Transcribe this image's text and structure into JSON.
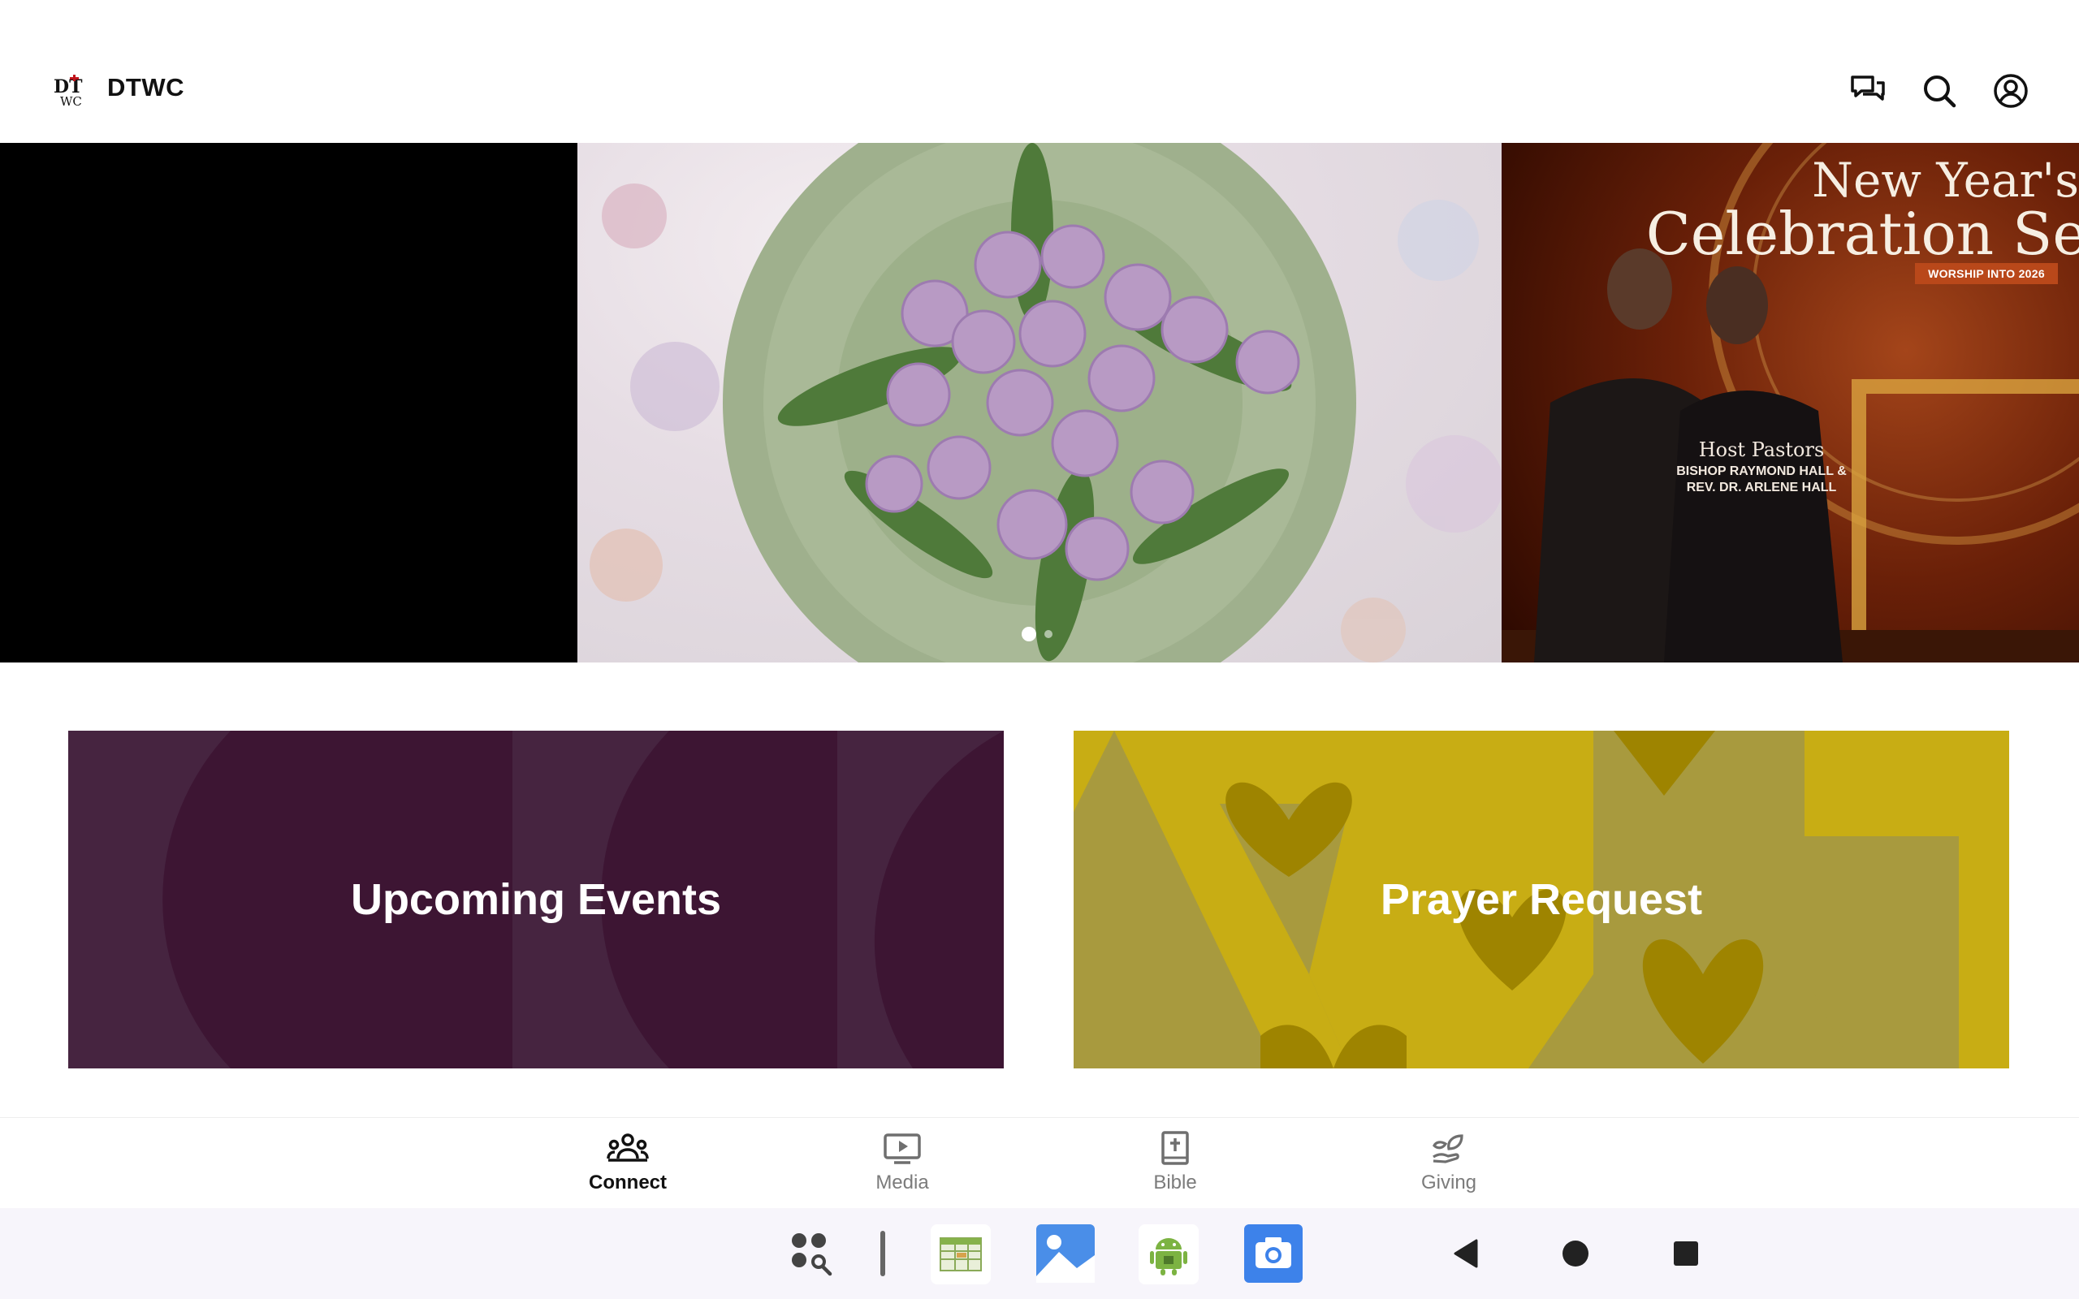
{
  "app": {
    "name": "DTWC",
    "logo_text": "DT WC"
  },
  "header_actions": [
    {
      "name": "messages",
      "icon": "chat-bubbles-icon"
    },
    {
      "name": "search",
      "icon": "search-icon"
    },
    {
      "name": "profile",
      "icon": "account-circle-icon"
    }
  ],
  "carousel": {
    "active_index": 0,
    "slide_count": 2,
    "banner": {
      "title_line1": "New Year's",
      "title_line2": "Celebration Se",
      "badge": "WORSHIP INTO 2026",
      "host_title": "Host Pastors",
      "host_line1": "BISHOP RAYMOND HALL &",
      "host_line2": "REV. DR. ARLENE HALL"
    }
  },
  "cards": [
    {
      "label": "Upcoming Events",
      "color": "#3d1533"
    },
    {
      "label": "Prayer Request",
      "color": "#a89a3e"
    }
  ],
  "bottom_nav": {
    "active": "Connect",
    "items": [
      {
        "label": "Connect",
        "icon": "people-group-icon"
      },
      {
        "label": "Media",
        "icon": "play-screen-icon"
      },
      {
        "label": "Bible",
        "icon": "bible-cross-icon"
      },
      {
        "label": "Giving",
        "icon": "hand-leaf-icon"
      }
    ]
  },
  "system_bar": {
    "apps": [
      "app-drawer-search-icon",
      "spreadsheet-app-icon",
      "gallery-app-icon",
      "android-app-icon",
      "camera-app-icon"
    ],
    "nav": [
      "back-icon",
      "home-icon",
      "recents-icon"
    ]
  }
}
